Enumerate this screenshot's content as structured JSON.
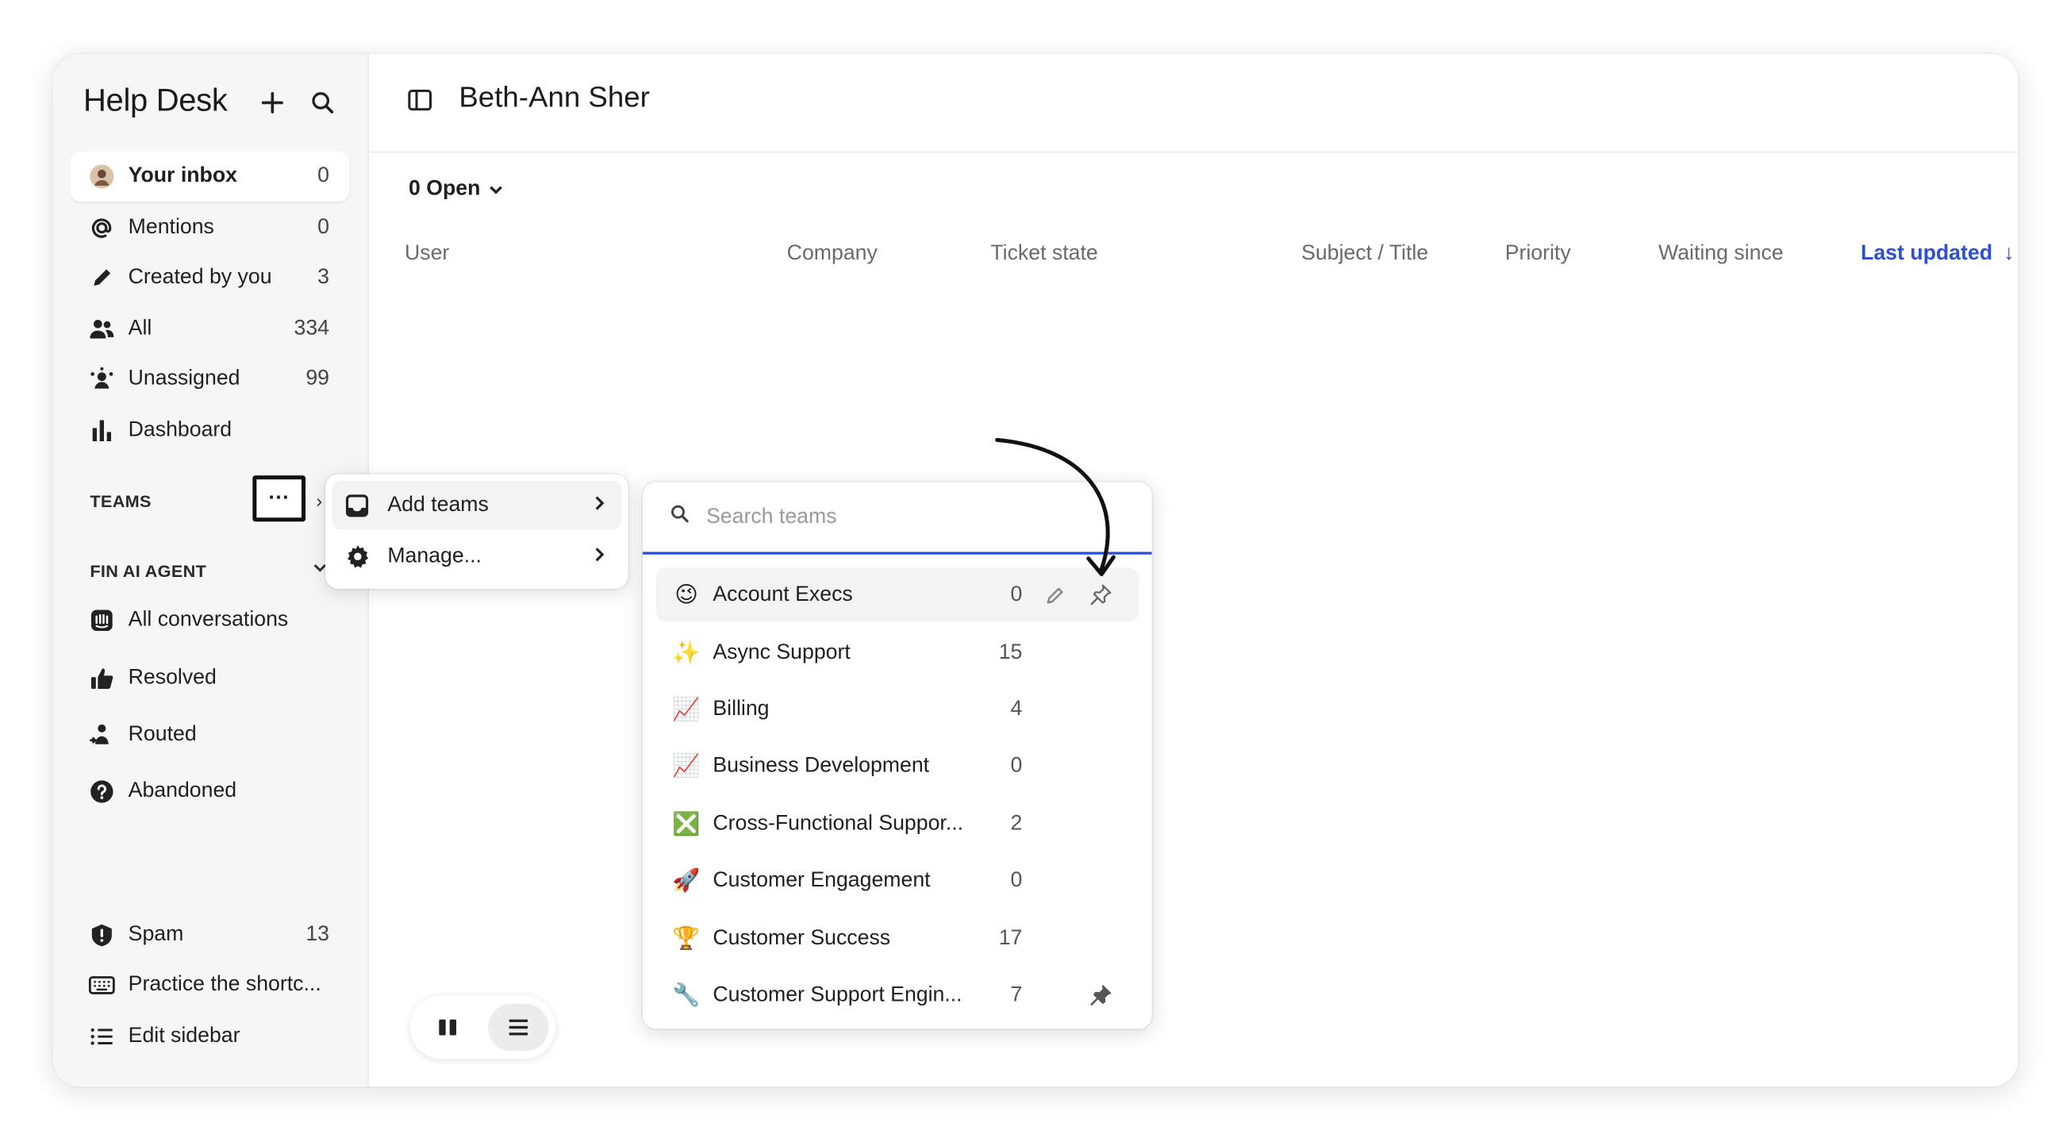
{
  "app": {
    "title": "Help Desk"
  },
  "sidebar": {
    "items": [
      {
        "label": "Your inbox",
        "count": "0",
        "icon": "avatar"
      },
      {
        "label": "Mentions",
        "count": "0",
        "icon": "at-icon"
      },
      {
        "label": "Created by you",
        "count": "3",
        "icon": "pencil-icon"
      },
      {
        "label": "All",
        "count": "334",
        "icon": "people-icon"
      },
      {
        "label": "Unassigned",
        "count": "99",
        "icon": "unassigned-icon"
      },
      {
        "label": "Dashboard",
        "count": "",
        "icon": "bar-chart-icon"
      }
    ],
    "teams_heading": "TEAMS",
    "teams_more": "···",
    "fin_heading": "FIN AI AGENT",
    "fin_items": [
      {
        "label": "All conversations",
        "icon": "fin-icon"
      },
      {
        "label": "Resolved",
        "icon": "thumbs-up-icon"
      },
      {
        "label": "Routed",
        "icon": "routed-icon"
      },
      {
        "label": "Abandoned",
        "icon": "question-icon"
      }
    ],
    "bottom_items": [
      {
        "label": "Spam",
        "count": "13",
        "icon": "spam-icon"
      },
      {
        "label": "Practice the shortc...",
        "count": "",
        "icon": "keyboard-icon"
      },
      {
        "label": "Edit sidebar",
        "count": "",
        "icon": "list-icon"
      }
    ]
  },
  "main": {
    "title": "Beth-Ann Sher",
    "filter_label": "0 Open",
    "columns": [
      "User",
      "Company",
      "Ticket state",
      "Subject / Title",
      "Priority",
      "Waiting since",
      "Last updated"
    ],
    "sorted_column": "Last updated"
  },
  "teams_menu": {
    "items": [
      {
        "label": "Add teams",
        "icon": "inbox-icon"
      },
      {
        "label": "Manage...",
        "icon": "gear-icon"
      }
    ]
  },
  "teams_picker": {
    "search_placeholder": "Search teams",
    "teams": [
      {
        "emoji": "😉",
        "label": "Account Execs",
        "count": "0",
        "pinned": false
      },
      {
        "emoji": "✨",
        "label": "Async Support",
        "count": "15",
        "pinned": false
      },
      {
        "emoji": "📈",
        "label": "Billing",
        "count": "4",
        "pinned": false
      },
      {
        "emoji": "📈",
        "label": "Business Development",
        "count": "0",
        "pinned": false
      },
      {
        "emoji": "❎",
        "label": "Cross-Functional Suppor...",
        "count": "2",
        "pinned": false
      },
      {
        "emoji": "🚀",
        "label": "Customer Engagement",
        "count": "0",
        "pinned": false
      },
      {
        "emoji": "🏆",
        "label": "Customer Success",
        "count": "17",
        "pinned": false
      },
      {
        "emoji": "🔧",
        "label": "Customer Support Engin...",
        "count": "7",
        "pinned": true
      }
    ]
  },
  "colors": {
    "accent": "#2d4fd8",
    "sidebar_bg": "#f6f6f6"
  }
}
